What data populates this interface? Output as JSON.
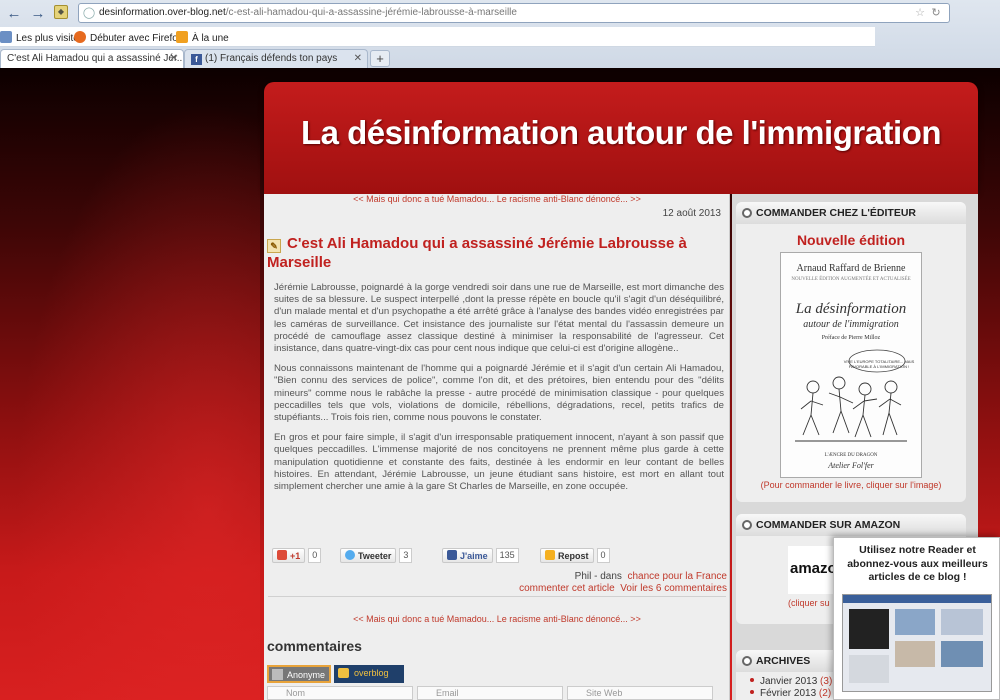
{
  "browser": {
    "url_domain": "desinformation.over-blog.net",
    "url_path": "/c-est-ali-hamadou-qui-a-assassine-jérémie-labrousse-à-marseille",
    "url_prefix": "",
    "bookmarks": [
      "Les plus visités",
      "Débuter avec Firefox",
      "À la une"
    ],
    "tabs": [
      {
        "label": "C'est Ali Hamadou qui a assassiné Jér...",
        "active": true
      },
      {
        "label": "(1) Français défends ton pays",
        "active": false
      }
    ],
    "new_tab": "+"
  },
  "banner": {
    "title": "La désinformation autour de l'immigration"
  },
  "post": {
    "prev_next_top": "<< Mais qui donc a tué Mamadou... Le racisme anti-Blanc dénoncé... >>",
    "date": "12 août 2013",
    "title": "C'est Ali Hamadou qui a assassiné Jérémie Labrousse à Marseille",
    "paragraphs": [
      "Jérémie Labrousse, poignardé à la gorge vendredi soir dans une rue de Marseille, est mort dimanche des suites de sa blessure. Le suspect interpellé ,dont la presse répète en boucle qu'il s'agit d'un déséquilibré, d'un malade mental et d'un psychopathe a été arrêté grâce à l'analyse des bandes vidéo enregistrées par les caméras de surveillance. Cet insistance des journaliste sur l'état mental du l'assassin demeure un procédé de camouflage assez classique destiné à minimiser la responsabilité de l'agresseur. Cet insistance, dans quatre-vingt-dix cas pour cent nous indique que celui-ci est d'origine allogène..",
      "Nous connaissons maintenant de l'homme qui a poignardé Jérémie et il s'agit d'un certain Ali Hamadou, \"Bien connu des services de police\", comme l'on dit, et des prétoires, bien entendu pour des \"délits mineurs\" comme nous le rabâche la presse - autre procédé de minimisation classique - pour quelques peccadilles tels que vols, violations de domicile, rébellions, dégradations, recel, petits trafics de stupéfiants... Trois fois rien, comme nous pouvons le constater.",
      "En gros et pour faire simple, il s'agit d'un irresponsable pratiquement innocent, n'ayant à son passif que quelques peccadilles. L'immense majorité de nos concitoyens ne prennent même plus garde à cette manipulation quotidienne et constante des faits, destinée à les endormir en leur contant de belles histoires. En attendant, Jérémie Labrousse, un jeune étudiant sans histoire, est mort en allant tout simplement chercher une amie à la gare St Charles de Marseille, en zone occupée."
    ],
    "share": {
      "gplus_label": "+1",
      "gplus_count": "0",
      "tweet_label": "Tweeter",
      "tweet_count": "3",
      "like_label": "J'aime",
      "like_count": "135",
      "repost_label": "Repost",
      "repost_count": "0"
    },
    "meta": {
      "author": "Phil - dans",
      "category": "chance pour la France",
      "comment_link": "commenter cet article",
      "view_comments": "Voir les 6 commentaires"
    },
    "prev_next_bottom": "<< Mais qui donc a tué Mamadou... Le racisme anti-Blanc dénoncé... >>"
  },
  "comments": {
    "heading": "commentaires",
    "tab_anonymous": "Anonyme",
    "tab_overblog": "overblog",
    "field_name": "Nom",
    "field_email": "Email",
    "field_site": "Site Web"
  },
  "sidebar": {
    "order_editor": {
      "heading": "COMMANDER CHEZ L'ÉDITEUR",
      "subtitle": "Nouvelle édition",
      "book_author": "Arnaud Raffard de Brienne",
      "book_edition": "NOUVELLE ÉDITION AUGMENTÉE ET ACTUALISÉE",
      "book_title": "La désinformation",
      "book_subtitle": "autour de l'immigration",
      "book_preface": "Préface de Pierre Milloz",
      "book_quote": "VIVE L'EUROPE TOTALITAIRE... MAIS FAVORABLE À L'IMMIGRATION !",
      "book_publisher_top": "L'ÆNCRE DU DRAGON",
      "book_publisher": "Atelier Fol'fer",
      "note": "(Pour commander le livre, cliquer sur l'image)"
    },
    "order_amazon": {
      "heading": "COMMANDER SUR AMAZON",
      "logo": "amazo",
      "note": "(cliquer su"
    },
    "archives": {
      "heading": "ARCHIVES",
      "items": [
        {
          "label": "Janvier 2013",
          "count": "(3)"
        },
        {
          "label": "Février 2013",
          "count": "(2)"
        }
      ]
    }
  },
  "reader": {
    "text": "Utilisez notre Reader et abonnez-vous aux meilleurs articles de ce blog !"
  }
}
